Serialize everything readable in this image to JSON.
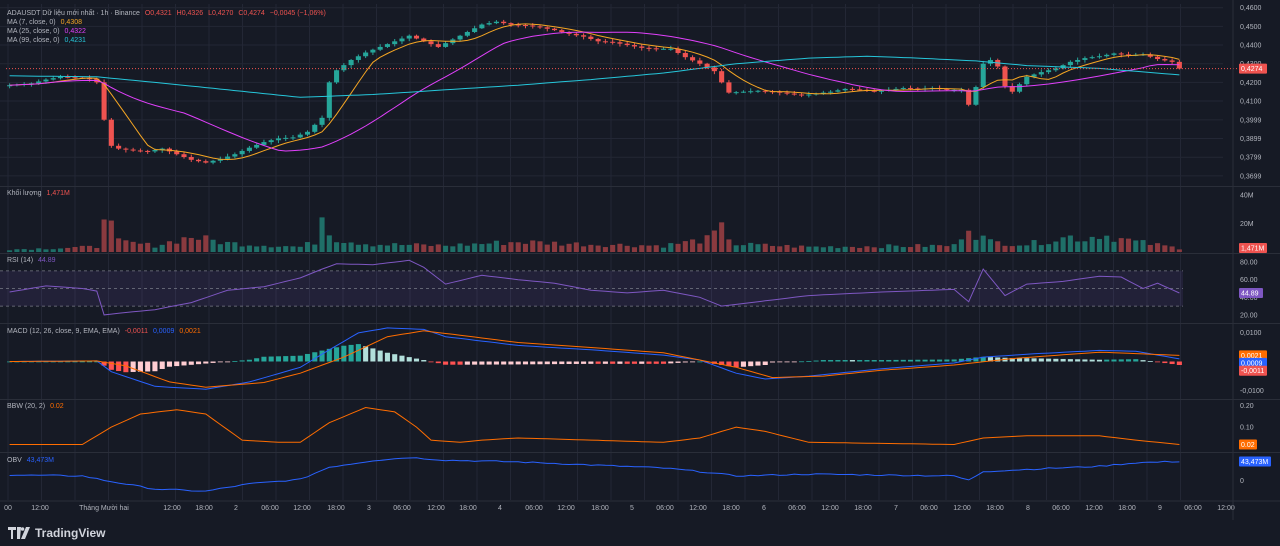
{
  "symbol_line": {
    "title": "ADAUSDT Dữ liệu mới nhất · 1h · Binance",
    "open": "O0,4321",
    "high": "H0,4326",
    "low": "L0,4270",
    "close": "C0,4274",
    "change": "−0,0045 (−1,06%)"
  },
  "price_legend": [
    {
      "label": "MA (7, close, 0)",
      "value": "0,4308",
      "color": "#f5a623"
    },
    {
      "label": "MA (25, close, 0)",
      "value": "0,4322",
      "color": "#e040fb"
    },
    {
      "label": "MA (99, close, 0)",
      "value": "0,4231",
      "color": "#26c6da"
    }
  ],
  "volume_legend": {
    "label": "Khối lượng",
    "value": "1,471M"
  },
  "rsi_legend": {
    "label": "RSI (14)",
    "value": "44.89"
  },
  "macd_legend": {
    "label": "MACD (12, 26, close, 9, EMA, EMA)",
    "v1": "-0,0011",
    "v2": "0,0009",
    "v3": "0,0021"
  },
  "bbw_legend": {
    "label": "BBW (20, 2)",
    "value": "0.02"
  },
  "obv_legend": {
    "label": "OBV",
    "value": "43,473M"
  },
  "brand": "TradingView",
  "colors": {
    "up": "#26a69a",
    "down": "#ef5350",
    "ma7": "#f5a623",
    "ma25": "#e040fb",
    "ma99": "#26c6da",
    "rsi": "#7e57c2",
    "macd": "#2962ff",
    "signal": "#ff6d00",
    "bbw": "#ff6d00",
    "obv": "#2962ff"
  },
  "chart_data": {
    "type": "candlestick",
    "time_axis": {
      "labels": [
        "00",
        "12:00",
        "Tháng Mười hai",
        "12:00",
        "18:00",
        "2",
        "06:00",
        "12:00",
        "18:00",
        "3",
        "06:00",
        "12:00",
        "18:00",
        "4",
        "06:00",
        "12:00",
        "18:00",
        "5",
        "06:00",
        "12:00",
        "18:00",
        "6",
        "06:00",
        "12:00",
        "18:00",
        "7",
        "06:00",
        "12:00",
        "18:00",
        "8",
        "06:00",
        "12:00",
        "18:00",
        "9",
        "06:00",
        "12:00"
      ]
    },
    "price_axis": {
      "ticks": [
        "0,4600",
        "0,4500",
        "0,4400",
        "0,4300",
        "0,4200",
        "0,4100",
        "0,3999",
        "0,3899",
        "0,3799",
        "0,3699"
      ],
      "ylim": [
        0.365,
        0.462
      ],
      "last_price_label": "0,4274",
      "current_close": 0.4274
    },
    "close_path": [
      [
        0,
        0.4185
      ],
      [
        3,
        0.4195
      ],
      [
        5,
        0.4215
      ],
      [
        7,
        0.423
      ],
      [
        9,
        0.4225
      ],
      [
        11,
        0.422
      ],
      [
        12,
        0.42
      ],
      [
        13,
        0.4
      ],
      [
        14,
        0.386
      ],
      [
        15,
        0.3845
      ],
      [
        17,
        0.3835
      ],
      [
        19,
        0.383
      ],
      [
        21,
        0.3845
      ],
      [
        23,
        0.3815
      ],
      [
        25,
        0.3785
      ],
      [
        27,
        0.377
      ],
      [
        29,
        0.379
      ],
      [
        31,
        0.3815
      ],
      [
        33,
        0.385
      ],
      [
        35,
        0.388
      ],
      [
        37,
        0.39
      ],
      [
        39,
        0.3905
      ],
      [
        41,
        0.3935
      ],
      [
        43,
        0.401
      ],
      [
        44,
        0.42
      ],
      [
        45,
        0.4265
      ],
      [
        47,
        0.432
      ],
      [
        49,
        0.436
      ],
      [
        51,
        0.439
      ],
      [
        53,
        0.442
      ],
      [
        55,
        0.445
      ],
      [
        57,
        0.442
      ],
      [
        59,
        0.439
      ],
      [
        61,
        0.443
      ],
      [
        63,
        0.447
      ],
      [
        65,
        0.451
      ],
      [
        67,
        0.4525
      ],
      [
        69,
        0.451
      ],
      [
        71,
        0.4505
      ],
      [
        73,
        0.4495
      ],
      [
        75,
        0.448
      ],
      [
        77,
        0.446
      ],
      [
        79,
        0.4445
      ],
      [
        81,
        0.442
      ],
      [
        83,
        0.4415
      ],
      [
        85,
        0.44
      ],
      [
        87,
        0.4385
      ],
      [
        89,
        0.438
      ],
      [
        91,
        0.438
      ],
      [
        93,
        0.4335
      ],
      [
        95,
        0.43
      ],
      [
        97,
        0.426
      ],
      [
        98,
        0.42
      ],
      [
        99,
        0.4145
      ],
      [
        101,
        0.415
      ],
      [
        103,
        0.4155
      ],
      [
        105,
        0.415
      ],
      [
        107,
        0.414
      ],
      [
        109,
        0.413
      ],
      [
        111,
        0.414
      ],
      [
        113,
        0.415
      ],
      [
        115,
        0.4165
      ],
      [
        117,
        0.416
      ],
      [
        119,
        0.415
      ],
      [
        121,
        0.416
      ],
      [
        123,
        0.417
      ],
      [
        125,
        0.4165
      ],
      [
        127,
        0.417
      ],
      [
        129,
        0.416
      ],
      [
        131,
        0.416
      ],
      [
        132,
        0.408
      ],
      [
        133,
        0.4175
      ],
      [
        134,
        0.43
      ],
      [
        135,
        0.432
      ],
      [
        136,
        0.4285
      ],
      [
        137,
        0.418
      ],
      [
        138,
        0.415
      ],
      [
        140,
        0.423
      ],
      [
        142,
        0.4255
      ],
      [
        144,
        0.4275
      ],
      [
        146,
        0.431
      ],
      [
        148,
        0.433
      ],
      [
        150,
        0.434
      ],
      [
        152,
        0.4355
      ],
      [
        154,
        0.4345
      ],
      [
        156,
        0.435
      ],
      [
        158,
        0.4325
      ],
      [
        160,
        0.431
      ],
      [
        161,
        0.4274
      ]
    ],
    "ma99_path": [
      [
        0,
        0.4235
      ],
      [
        12,
        0.423
      ],
      [
        20,
        0.42
      ],
      [
        30,
        0.416
      ],
      [
        40,
        0.412
      ],
      [
        50,
        0.4135
      ],
      [
        60,
        0.416
      ],
      [
        70,
        0.4185
      ],
      [
        80,
        0.4215
      ],
      [
        90,
        0.425
      ],
      [
        100,
        0.43
      ],
      [
        110,
        0.433
      ],
      [
        118,
        0.434
      ],
      [
        125,
        0.433
      ],
      [
        133,
        0.4315
      ],
      [
        140,
        0.429
      ],
      [
        150,
        0.4275
      ],
      [
        161,
        0.424
      ]
    ],
    "volume_axis": {
      "ticks": [
        "40M",
        "20M"
      ],
      "last_label": "1,471M",
      "max": 45
    },
    "volume_path": [
      [
        0,
        2
      ],
      [
        12,
        4
      ],
      [
        13,
        38
      ],
      [
        14,
        20
      ],
      [
        15,
        8
      ],
      [
        20,
        5
      ],
      [
        25,
        12
      ],
      [
        30,
        7
      ],
      [
        40,
        4
      ],
      [
        42,
        8
      ],
      [
        43,
        30
      ],
      [
        44,
        18
      ],
      [
        45,
        10
      ],
      [
        50,
        6
      ],
      [
        60,
        5
      ],
      [
        70,
        8
      ],
      [
        80,
        6
      ],
      [
        90,
        5
      ],
      [
        96,
        10
      ],
      [
        98,
        18
      ],
      [
        100,
        6
      ],
      [
        110,
        4
      ],
      [
        130,
        5
      ],
      [
        132,
        22
      ],
      [
        133,
        14
      ],
      [
        135,
        8
      ],
      [
        140,
        6
      ],
      [
        146,
        12
      ],
      [
        148,
        10
      ],
      [
        150,
        14
      ],
      [
        155,
        8
      ],
      [
        161,
        3
      ]
    ],
    "rsi_axis": {
      "ticks": [
        "80.00",
        "60.00",
        "40.00",
        "20.00"
      ],
      "levels": [
        70,
        50,
        30
      ],
      "last_label": "44.89",
      "ylim": [
        12,
        88
      ]
    },
    "rsi_path": [
      [
        0,
        46
      ],
      [
        5,
        53
      ],
      [
        10,
        50
      ],
      [
        12,
        47
      ],
      [
        13,
        20
      ],
      [
        15,
        22
      ],
      [
        20,
        26
      ],
      [
        25,
        34
      ],
      [
        30,
        48
      ],
      [
        35,
        52
      ],
      [
        40,
        62
      ],
      [
        43,
        72
      ],
      [
        45,
        78
      ],
      [
        50,
        77
      ],
      [
        55,
        82
      ],
      [
        57,
        74
      ],
      [
        60,
        55
      ],
      [
        65,
        65
      ],
      [
        70,
        60
      ],
      [
        75,
        56
      ],
      [
        80,
        48
      ],
      [
        85,
        45
      ],
      [
        90,
        48
      ],
      [
        95,
        40
      ],
      [
        98,
        30
      ],
      [
        100,
        32
      ],
      [
        110,
        42
      ],
      [
        120,
        46
      ],
      [
        130,
        49
      ],
      [
        132,
        35
      ],
      [
        134,
        72
      ],
      [
        137,
        42
      ],
      [
        140,
        55
      ],
      [
        145,
        58
      ],
      [
        150,
        64
      ],
      [
        153,
        63
      ],
      [
        156,
        50
      ],
      [
        158,
        56
      ],
      [
        161,
        44.89
      ]
    ],
    "macd_axis": {
      "ticks": [
        "0,0100",
        "0,0000",
        "-0,0100"
      ],
      "last_labels": [
        "0,0021",
        "0,0009",
        "-0,0011"
      ],
      "ylim": [
        -0.0125,
        0.0125
      ]
    },
    "macd_path": [
      [
        0,
        0
      ],
      [
        12,
        0.0002
      ],
      [
        14,
        -0.0035
      ],
      [
        20,
        -0.0085
      ],
      [
        27,
        -0.0095
      ],
      [
        33,
        -0.007
      ],
      [
        40,
        -0.002
      ],
      [
        44,
        0.004
      ],
      [
        48,
        0.0098
      ],
      [
        52,
        0.0115
      ],
      [
        57,
        0.011
      ],
      [
        60,
        0.0085
      ],
      [
        70,
        0.0055
      ],
      [
        80,
        0.004
      ],
      [
        90,
        0.0022
      ],
      [
        95,
        0.0005
      ],
      [
        100,
        -0.004
      ],
      [
        104,
        -0.006
      ],
      [
        110,
        -0.005
      ],
      [
        120,
        -0.0025
      ],
      [
        130,
        -0.0005
      ],
      [
        134,
        0.0015
      ],
      [
        140,
        0.0025
      ],
      [
        150,
        0.0038
      ],
      [
        155,
        0.0035
      ],
      [
        161,
        0.0009
      ]
    ],
    "signal_path": [
      [
        0,
        0
      ],
      [
        12,
        0.0002
      ],
      [
        16,
        -0.0015
      ],
      [
        22,
        -0.007
      ],
      [
        27,
        -0.0088
      ],
      [
        35,
        -0.0072
      ],
      [
        40,
        -0.004
      ],
      [
        46,
        0.0015
      ],
      [
        52,
        0.0085
      ],
      [
        57,
        0.0105
      ],
      [
        62,
        0.009
      ],
      [
        70,
        0.0065
      ],
      [
        80,
        0.0048
      ],
      [
        90,
        0.003
      ],
      [
        100,
        -0.002
      ],
      [
        105,
        -0.0055
      ],
      [
        112,
        -0.005
      ],
      [
        120,
        -0.003
      ],
      [
        130,
        -0.0012
      ],
      [
        138,
        0.001
      ],
      [
        150,
        0.0032
      ],
      [
        161,
        0.0021
      ]
    ],
    "bbw_axis": {
      "ticks": [
        "0.20",
        "0.10",
        "0.00"
      ],
      "last_label": "0.02",
      "ylim": [
        -0.01,
        0.22
      ]
    },
    "bbw_path": [
      [
        0,
        0.02
      ],
      [
        10,
        0.02
      ],
      [
        14,
        0.1
      ],
      [
        18,
        0.16
      ],
      [
        23,
        0.18
      ],
      [
        27,
        0.16
      ],
      [
        32,
        0.04
      ],
      [
        37,
        0.03
      ],
      [
        40,
        0.03
      ],
      [
        44,
        0.12
      ],
      [
        49,
        0.19
      ],
      [
        53,
        0.17
      ],
      [
        56,
        0.1
      ],
      [
        58,
        0.04
      ],
      [
        62,
        0.03
      ],
      [
        65,
        0.04
      ],
      [
        70,
        0.05
      ],
      [
        80,
        0.04
      ],
      [
        90,
        0.03
      ],
      [
        95,
        0.05
      ],
      [
        100,
        0.1
      ],
      [
        104,
        0.08
      ],
      [
        110,
        0.03
      ],
      [
        130,
        0.02
      ],
      [
        134,
        0.05
      ],
      [
        140,
        0.06
      ],
      [
        150,
        0.06
      ],
      [
        155,
        0.04
      ],
      [
        161,
        0.02
      ]
    ],
    "obv_axis": {
      "ticks": [
        "0"
      ],
      "last_label": "43,473M",
      "ylim": [
        -45,
        60
      ]
    },
    "obv_path": [
      [
        0,
        12
      ],
      [
        10,
        10
      ],
      [
        13,
        0
      ],
      [
        20,
        -20
      ],
      [
        27,
        -25
      ],
      [
        33,
        -8
      ],
      [
        40,
        2
      ],
      [
        44,
        30
      ],
      [
        50,
        45
      ],
      [
        55,
        52
      ],
      [
        60,
        46
      ],
      [
        70,
        42
      ],
      [
        80,
        35
      ],
      [
        90,
        28
      ],
      [
        95,
        20
      ],
      [
        100,
        10
      ],
      [
        110,
        14
      ],
      [
        120,
        12
      ],
      [
        130,
        10
      ],
      [
        132,
        0
      ],
      [
        134,
        20
      ],
      [
        140,
        25
      ],
      [
        150,
        32
      ],
      [
        155,
        40
      ],
      [
        161,
        43
      ]
    ]
  }
}
